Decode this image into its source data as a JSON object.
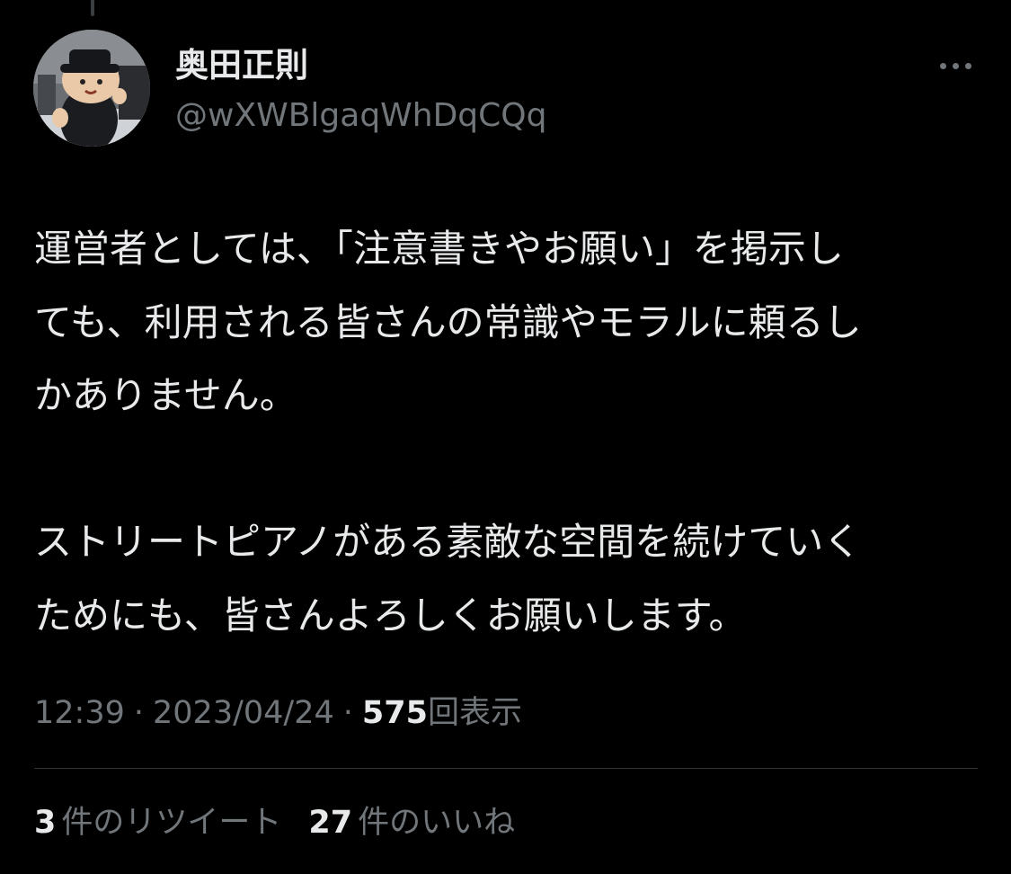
{
  "tweet": {
    "author": {
      "display_name": "奥田正則",
      "handle": "@wXWBlgaqWhDqCQq"
    },
    "text_lines": [
      "運営者としては、「注意書きやお願い」を掲示し",
      "ても、利用される皆さんの常識やモラルに頼るし",
      "かありません。",
      "",
      "ストリートピアノがある素敵な空間を続けていく",
      "ためにも、皆さんよろしくお願いします。"
    ],
    "time": "12:39",
    "date": "2023/04/24",
    "separator": "·",
    "views_count": "575",
    "views_label": "回表示",
    "retweets_count": "3",
    "retweets_label": "件のリツイート",
    "likes_count": "27",
    "likes_label": "件のいいね"
  },
  "icons": {
    "more": "more-horizontal-icon"
  },
  "colors": {
    "background": "#000000",
    "primary_text": "#e7e9ea",
    "secondary_text": "#71767b",
    "divider": "#2f3336"
  }
}
